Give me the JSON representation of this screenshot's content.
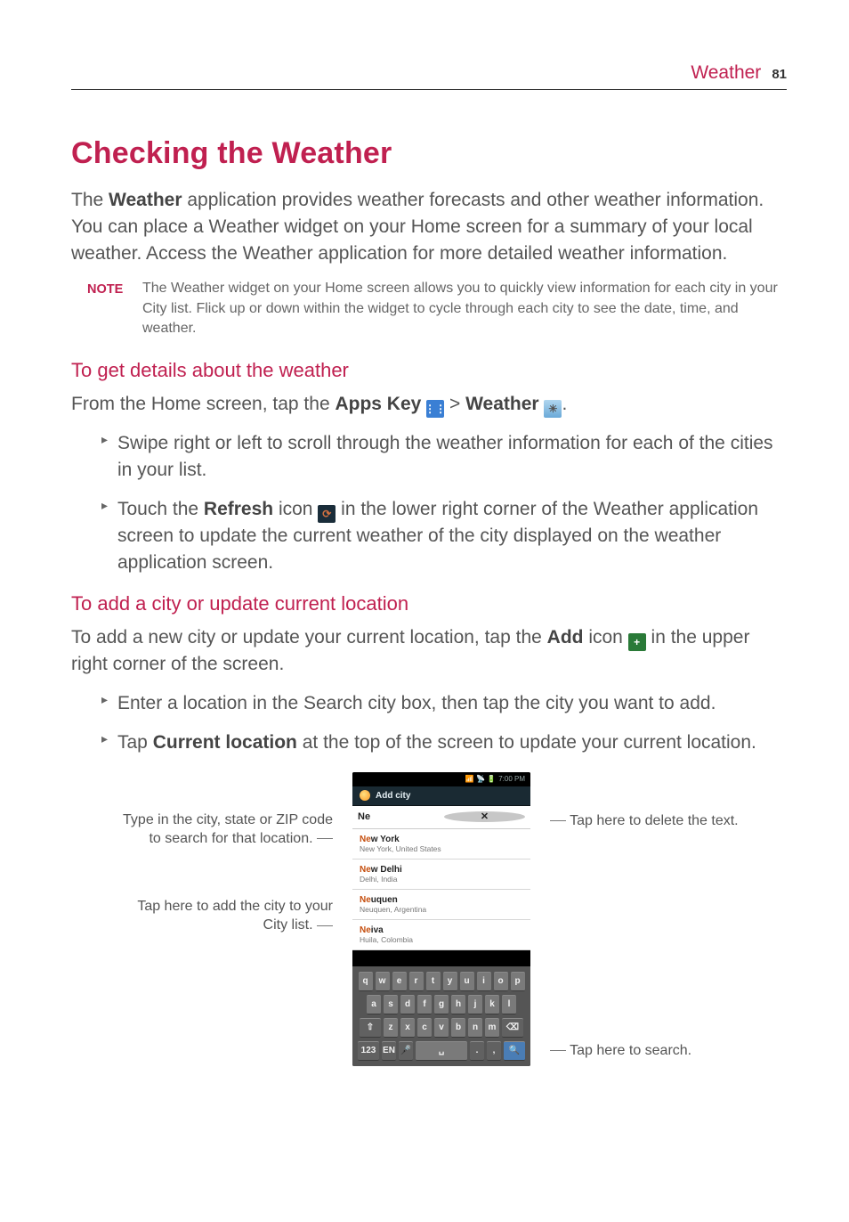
{
  "header": {
    "section": "Weather",
    "page_number": "81"
  },
  "title": "Checking the Weather",
  "intro_prefix": "The ",
  "intro_bold": "Weather",
  "intro_rest": " application provides weather forecasts and other weather information. You can place a Weather widget on your Home screen for a summary of your local weather. Access the Weather application for more detailed weather information.",
  "note_label": "NOTE",
  "note_text": "The Weather widget on your Home screen allows you to quickly view information for each city in your City list. Flick up or down within the widget to cycle through each city to see the date, time, and weather.",
  "sub1": "To get details about the weather",
  "sub1_line_pre": "From the Home screen, tap the ",
  "sub1_apps_key": "Apps Key",
  "sub1_gt": " > ",
  "sub1_weather": "Weather",
  "sub1_period": ".",
  "bul1": "Swipe right or left to scroll through the weather information for each of the cities in your list.",
  "bul2_pre": "Touch the ",
  "bul2_bold": "Refresh",
  "bul2_mid": " icon ",
  "bul2_rest": " in the lower right corner of the Weather application screen to update the current weather of the city displayed on the weather application screen.",
  "sub2": "To add a city or update current location",
  "sub2_line_pre": "To add a new city or update your current location, tap the ",
  "sub2_bold": "Add",
  "sub2_mid": " icon ",
  "sub2_rest": " in the upper right corner of the screen.",
  "bul3": "Enter a location in the Search city box, then tap the city you want to add.",
  "bul4_pre": "Tap ",
  "bul4_bold": "Current location",
  "bul4_rest": " at the top of the screen to update your current location.",
  "callouts": {
    "left_top": "Type in the city, state or ZIP code to search for that location.",
    "left_mid": "Tap here to add the city to your City list.",
    "right_top": "Tap here to delete the text.",
    "right_bot": "Tap here to search."
  },
  "phone": {
    "status_time": "7:00 PM",
    "status_icons": "📶 📡 🔋",
    "titlebar": "Add city",
    "search_value": "Ne",
    "results": [
      {
        "match": "Ne",
        "rest": "w York",
        "sub": "New York, United States"
      },
      {
        "match": "Ne",
        "rest": "w Delhi",
        "sub": "Delhi, India"
      },
      {
        "match": "Ne",
        "rest": "uquen",
        "sub": "Neuquen, Argentina"
      },
      {
        "match": "Ne",
        "rest": "iva",
        "sub": "Huila, Colombia"
      }
    ],
    "kb_rows": [
      [
        "q",
        "w",
        "e",
        "r",
        "t",
        "y",
        "u",
        "i",
        "o",
        "p"
      ],
      [
        "a",
        "s",
        "d",
        "f",
        "g",
        "h",
        "j",
        "k",
        "l"
      ],
      [
        "⇧",
        "z",
        "x",
        "c",
        "v",
        "b",
        "n",
        "m",
        "⌫"
      ],
      [
        "123",
        "EN",
        "🎤",
        "␣",
        ".",
        ",",
        "🔍"
      ]
    ]
  }
}
